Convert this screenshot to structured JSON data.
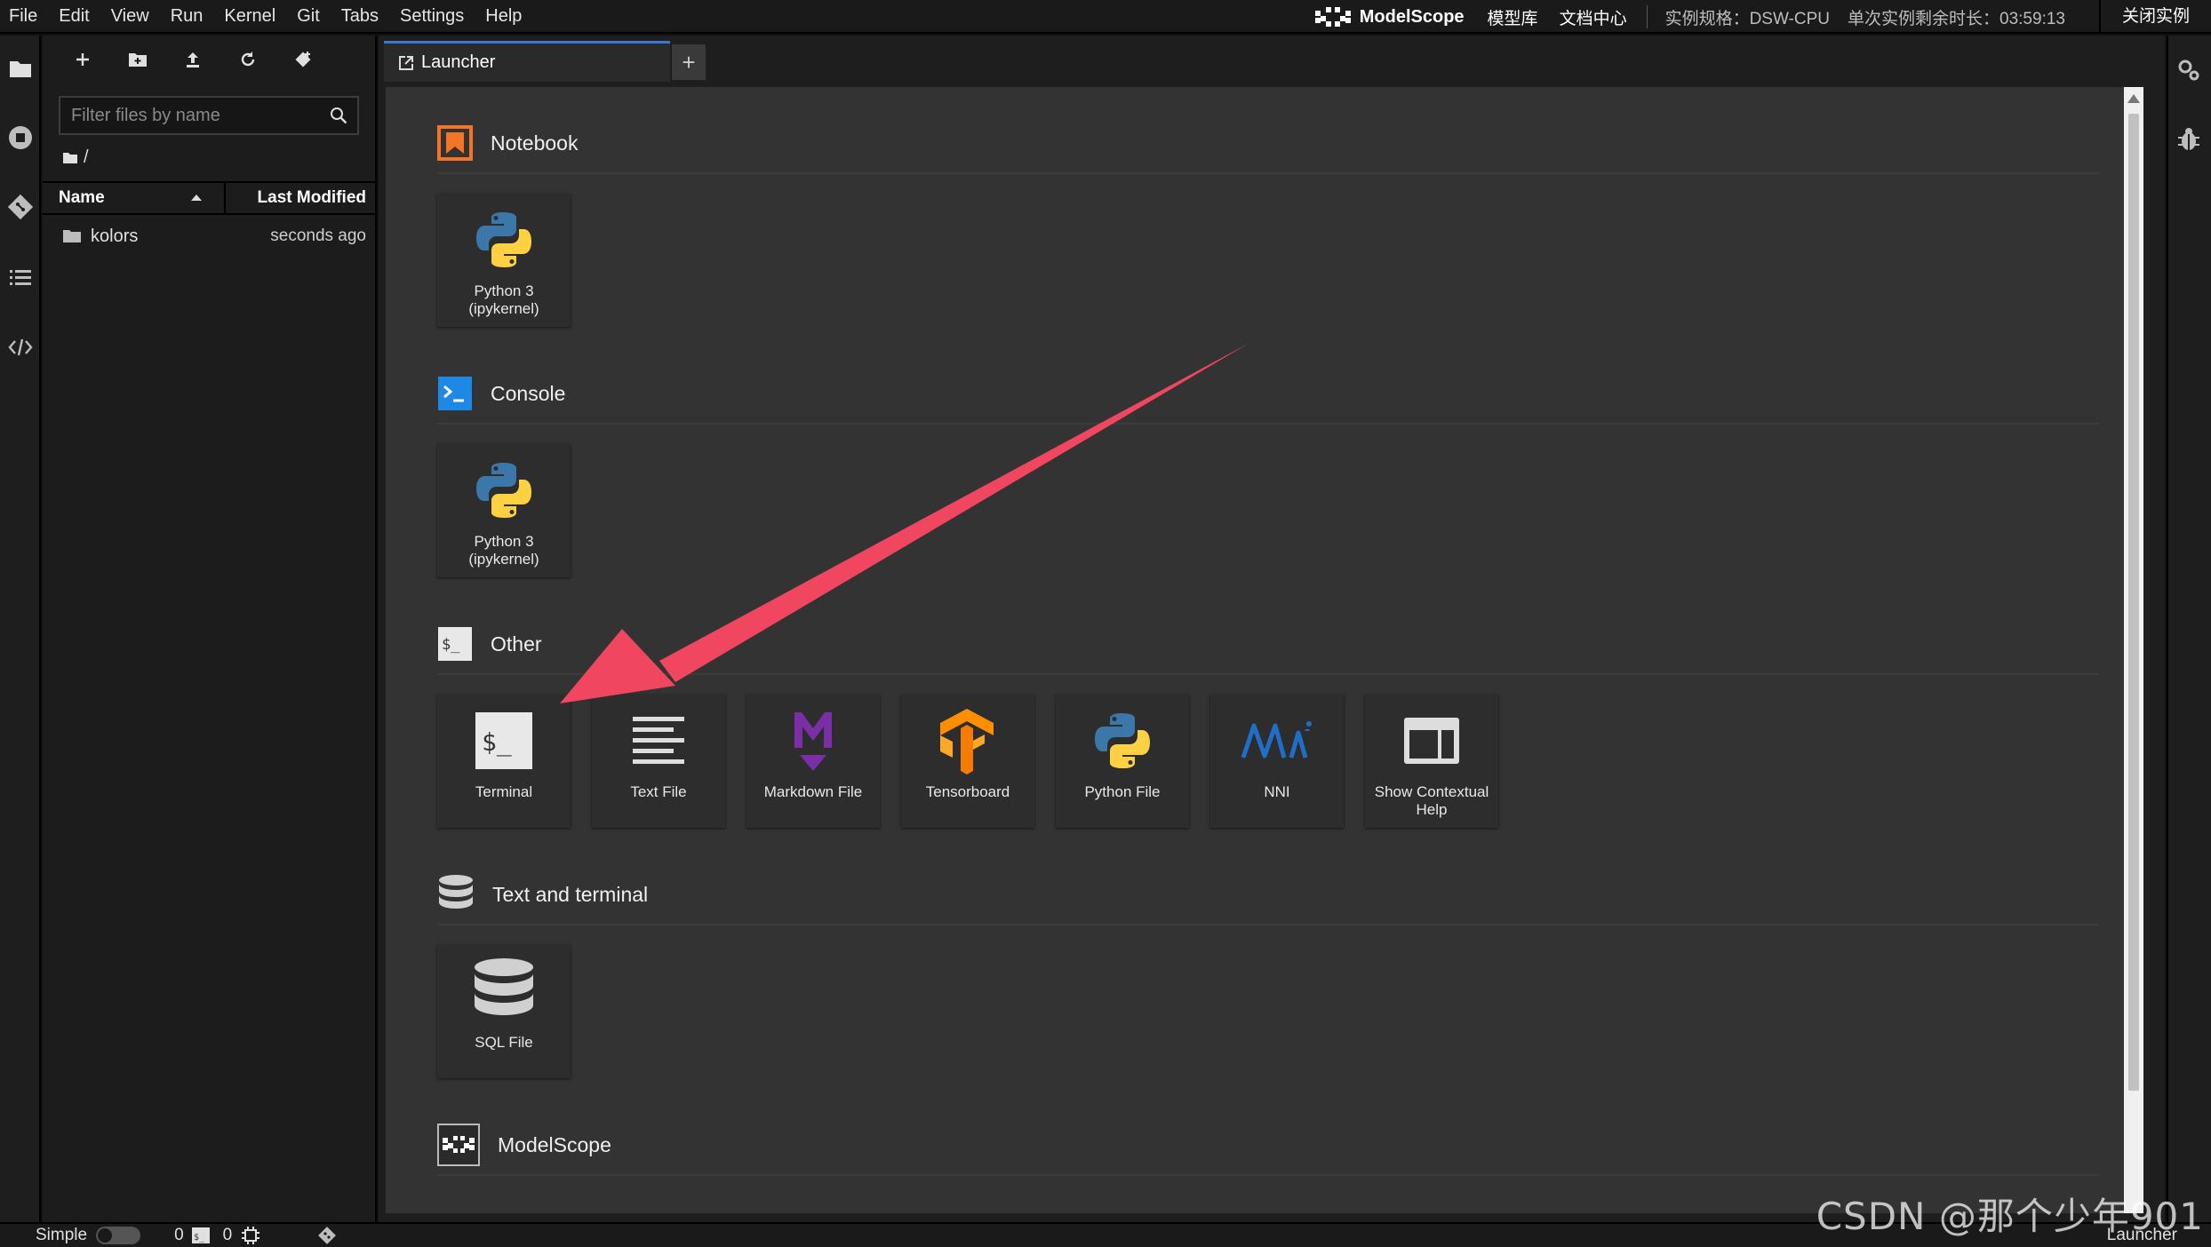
{
  "menu": [
    "File",
    "Edit",
    "View",
    "Run",
    "Kernel",
    "Git",
    "Tabs",
    "Settings",
    "Help"
  ],
  "header": {
    "brand": "ModelScope",
    "links": [
      "模型库",
      "文档中心"
    ],
    "spec": "实例规格：DSW-CPU",
    "remaining": "单次实例剩余时长：03:59:13",
    "close_label": "关闭实例"
  },
  "filebrowser": {
    "search_placeholder": "Filter files by name",
    "breadcrumb": "/",
    "col_name": "Name",
    "col_modified": "Last Modified",
    "rows": [
      {
        "name": "kolors",
        "modified": "seconds ago"
      }
    ]
  },
  "tabs": {
    "active_label": "Launcher",
    "add_label": "+"
  },
  "launcher": {
    "notebook": {
      "title": "Notebook",
      "cards": [
        {
          "label": "Python 3 (ipykernel)"
        }
      ]
    },
    "console": {
      "title": "Console",
      "cards": [
        {
          "label": "Python 3 (ipykernel)"
        }
      ]
    },
    "other": {
      "title": "Other",
      "cards": [
        {
          "label": "Terminal"
        },
        {
          "label": "Text File"
        },
        {
          "label": "Markdown File"
        },
        {
          "label": "Tensorboard"
        },
        {
          "label": "Python File"
        },
        {
          "label": "NNI"
        },
        {
          "label": "Show Contextual Help"
        }
      ]
    },
    "text_terminal": {
      "title": "Text and terminal",
      "cards": [
        {
          "label": "SQL File"
        }
      ]
    },
    "modelscope": {
      "title": "ModelScope"
    }
  },
  "statusbar": {
    "mode": "Simple",
    "terminals": "0",
    "kernels": "0",
    "right": "Launcher"
  },
  "watermark": "CSDN @那个少年901",
  "colors": {
    "accent": "#3a78d6",
    "arrow": "#f0465f",
    "notebook_icon": "#f37626",
    "console_icon": "#1e88e5"
  }
}
